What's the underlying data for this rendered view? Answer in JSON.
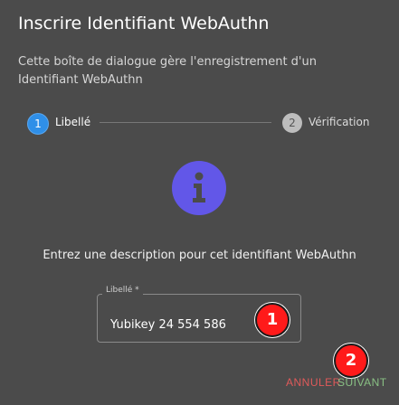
{
  "dialog": {
    "title": "Inscrire Identifiant WebAuthn",
    "description": "Cette boîte de dialogue gère l'enregistrement d'un Identifiant WebAuthn"
  },
  "stepper": {
    "steps": [
      {
        "number": "1",
        "label": "Libellé",
        "state": "active"
      },
      {
        "number": "2",
        "label": "Vérification",
        "state": "inactive"
      }
    ]
  },
  "main": {
    "icon": "info-icon",
    "prompt": "Entrez une description pour cet identifiant WebAuthn"
  },
  "form": {
    "label_field": {
      "label": "Libellé *",
      "value": "Yubikey 24 554 586"
    }
  },
  "annotations": {
    "badge1": "1",
    "badge2": "2"
  },
  "actions": {
    "cancel_label": "ANNULER",
    "next_label": "SUIVANT"
  },
  "colors": {
    "background": "#4b4b4b",
    "accent": "#2f8fe8",
    "icon_purple": "#6257e8",
    "cancel": "#e05a5a",
    "next": "#89c084",
    "badge": "#ff1a1a"
  }
}
